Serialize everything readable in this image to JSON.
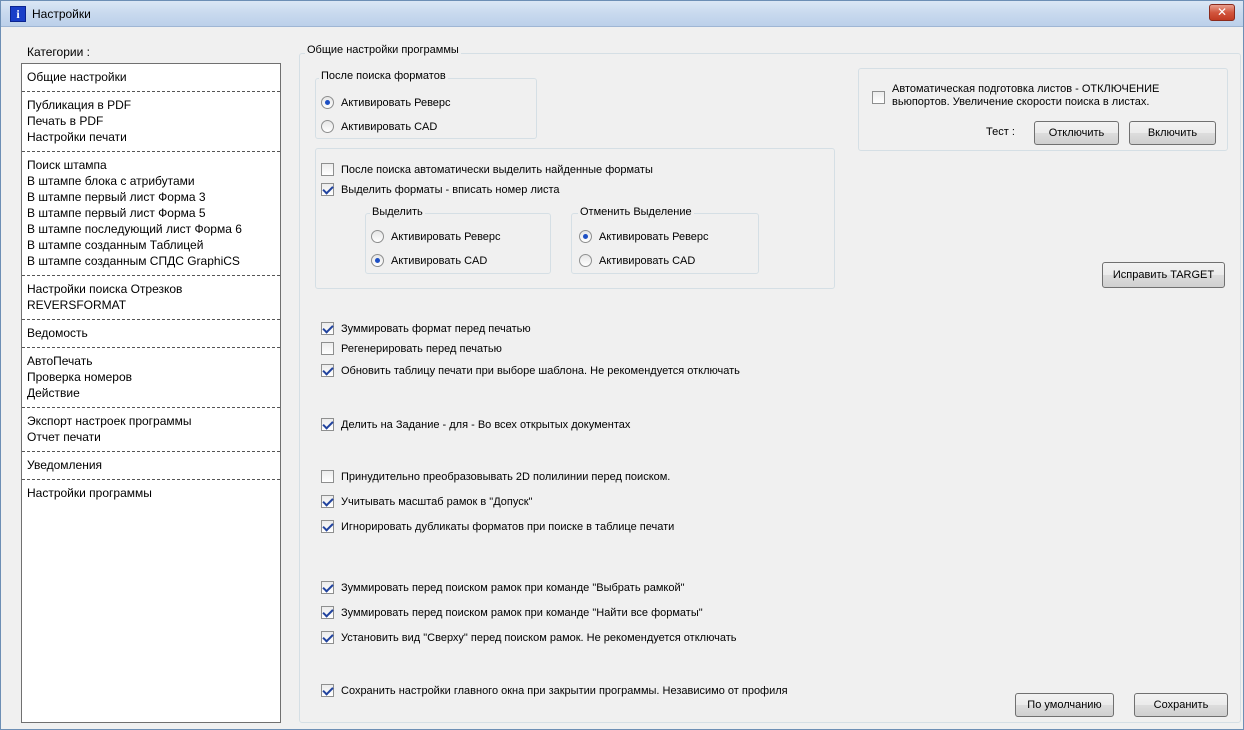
{
  "window": {
    "title": "Настройки",
    "close_glyph": "✕"
  },
  "categories": {
    "label": "Категории :",
    "groups": [
      [
        "Общие настройки"
      ],
      [
        "Публикация в PDF",
        "Печать в PDF",
        "Настройки печати"
      ],
      [
        "Поиск штампа",
        "В штампе блока с атрибутами",
        "В штампе первый лист Форма 3",
        "В штампе первый лист Форма 5",
        "В штампе последующий лист Форма 6",
        "В штампе созданным Таблицей",
        "В штампе созданным СПДС GraphiCS"
      ],
      [
        "Настройки поиска Отрезков",
        "REVERSFORMAT"
      ],
      [
        "Ведомость"
      ],
      [
        "АвтоПечать",
        "Проверка номеров",
        "Действие"
      ],
      [
        "Экспорт настроек программы",
        "Отчет печати"
      ],
      [
        "Уведомления"
      ],
      [
        "Настройки программы"
      ]
    ]
  },
  "main": {
    "title": "Общие настройки программы",
    "after_search": {
      "title": "После поиска форматов",
      "opt_reverse": "Активировать Реверс",
      "opt_cad": "Активировать CAD",
      "selected": "reverse"
    },
    "auto_select": {
      "label": "После поиска автоматически выделить найденные форматы",
      "checked": false
    },
    "select_insert": {
      "label": "Выделить форматы - вписать номер листа",
      "checked": true
    },
    "select_group": {
      "title": "Выделить",
      "opt_reverse": "Активировать Реверс",
      "opt_cad": "Активировать CAD",
      "selected": "cad"
    },
    "deselect_group": {
      "title": "Отменить Выделение",
      "opt_reverse": "Активировать Реверс",
      "opt_cad": "Активировать CAD",
      "selected": "reverse"
    },
    "checks": [
      {
        "label": "Зуммировать формат перед печатью",
        "checked": true
      },
      {
        "label": "Регенерировать перед печатью",
        "checked": false
      },
      {
        "label": "Обновить таблицу печати при выборе шаблона. Не рекомендуется отключать",
        "checked": true
      },
      {
        "label": "Делить на Задание - для - Во всех открытых документах",
        "checked": true
      },
      {
        "label": "Принудительно преобразовывать 2D полилинии перед поиском.",
        "checked": false
      },
      {
        "label": "Учитывать масштаб рамок в \"Допуск\"",
        "checked": true
      },
      {
        "label": "Игнорировать дубликаты форматов при поиске в таблице печати",
        "checked": true
      },
      {
        "label": "Зуммировать перед поиском рамок при команде \"Выбрать рамкой\"",
        "checked": true
      },
      {
        "label": "Зуммировать перед поиском рамок при команде \"Найти все форматы\"",
        "checked": true
      },
      {
        "label": "Установить вид \"Сверху\" перед поиском рамок. Не рекомендуется отключать",
        "checked": true
      },
      {
        "label": "Сохранить настройки главного окна при закрытии программы. Независимо от профиля",
        "checked": true
      }
    ],
    "auto_prep": {
      "line1": "Автоматическая подготовка листов - ОТКЛЮЧЕНИЕ",
      "line2": "вьюпортов. Увеличение скорости поиска в листах.",
      "checked": false,
      "test_label": "Тест :",
      "disable_btn": "Отключить",
      "enable_btn": "Включить"
    },
    "fix_target_btn": "Исправить TARGET",
    "default_btn": "По умолчанию",
    "save_btn": "Сохранить"
  }
}
